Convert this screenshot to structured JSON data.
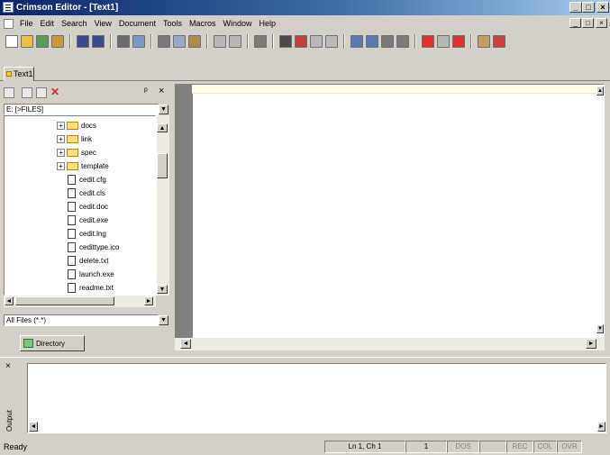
{
  "window": {
    "title": "Crimson Editor - [Text1]"
  },
  "caption_buttons": {
    "minimize": "_",
    "maximize": "□",
    "close": "×"
  },
  "menu": {
    "items": [
      "File",
      "Edit",
      "Search",
      "View",
      "Document",
      "Tools",
      "Macros",
      "Window",
      "Help"
    ]
  },
  "toolbar": {
    "buttons": [
      {
        "icon": "new-file-icon",
        "color": "#ffffff"
      },
      {
        "icon": "open-folder-icon",
        "color": "#e8c04a"
      },
      {
        "icon": "reload-icon",
        "color": "#5a9a5a"
      },
      {
        "icon": "open-remote-icon",
        "color": "#c89a3a"
      },
      {
        "sep": true
      },
      {
        "icon": "save-icon",
        "color": "#3a4a8a"
      },
      {
        "icon": "save-all-icon",
        "color": "#3a4a8a"
      },
      {
        "sep": true
      },
      {
        "icon": "print-icon",
        "color": "#6a6a6a"
      },
      {
        "icon": "print-preview-icon",
        "color": "#7a9ac8"
      },
      {
        "sep": true
      },
      {
        "icon": "cut-icon",
        "color": "#7a7a7a"
      },
      {
        "icon": "copy-icon",
        "color": "#9aa8c8"
      },
      {
        "icon": "paste-icon",
        "color": "#b08a4a"
      },
      {
        "sep": true
      },
      {
        "icon": "undo-icon",
        "color": "#b8b8b8"
      },
      {
        "icon": "redo-icon",
        "color": "#b8b8b8"
      },
      {
        "sep": true
      },
      {
        "icon": "toggle-pane-icon",
        "color": "#7a7a7a"
      },
      {
        "sep": true
      },
      {
        "icon": "find-icon",
        "color": "#4a4a4a"
      },
      {
        "icon": "find-next-icon",
        "color": "#c04040"
      },
      {
        "icon": "find-prev-icon",
        "color": "#b8b8b8"
      },
      {
        "icon": "replace-icon",
        "color": "#b8b8b8"
      },
      {
        "sep": true
      },
      {
        "icon": "word-wrap-icon",
        "color": "#5a7ab0"
      },
      {
        "icon": "column-mode-icon",
        "color": "#5a7ab0"
      },
      {
        "icon": "spell-check-icon",
        "color": "#7a7a7a"
      },
      {
        "icon": "bookmark-icon",
        "color": "#7a7a7a"
      },
      {
        "sep": true
      },
      {
        "icon": "record-macro-icon",
        "color": "#e03030"
      },
      {
        "icon": "stop-macro-icon",
        "color": "#b8b8b8"
      },
      {
        "icon": "play-macro-icon",
        "color": "#e03030"
      },
      {
        "sep": true
      },
      {
        "icon": "help-icon",
        "color": "#c0a060"
      },
      {
        "icon": "about-icon",
        "color": "#c84040"
      }
    ]
  },
  "tabs": [
    {
      "label": "Text1"
    }
  ],
  "left_pane": {
    "pin_label": "ᵖ",
    "close_label": "×",
    "drive": "E: [>FILES]",
    "tree": [
      {
        "label": "docs",
        "type": "folder",
        "expander": "+"
      },
      {
        "label": "link",
        "type": "folder",
        "expander": "+"
      },
      {
        "label": "spec",
        "type": "folder",
        "expander": "+"
      },
      {
        "label": "template",
        "type": "folder",
        "expander": "+"
      },
      {
        "label": "cedit.cfg",
        "type": "file"
      },
      {
        "label": "cedit.cls",
        "type": "file"
      },
      {
        "label": "cedit.doc",
        "type": "file"
      },
      {
        "label": "cedit.exe",
        "type": "file"
      },
      {
        "label": "cedit.lng",
        "type": "file"
      },
      {
        "label": "cedittype.ico",
        "type": "file"
      },
      {
        "label": "delete.txt",
        "type": "file"
      },
      {
        "label": "launch.exe",
        "type": "file"
      },
      {
        "label": "readme.txt",
        "type": "file"
      }
    ],
    "filter": "All Files (*.*)",
    "tab_label": "Directory"
  },
  "output": {
    "label": "Output"
  },
  "status": {
    "ready": "Ready",
    "position": "Ln 1, Ch 1",
    "col": "1",
    "ovr_modes": [
      "DOS",
      "",
      "REC",
      "COL",
      "OVR"
    ]
  },
  "colors": {
    "title_start": "#0a246a",
    "title_end": "#a6caf0",
    "face": "#d4d0c8",
    "shadow": "#808080"
  }
}
